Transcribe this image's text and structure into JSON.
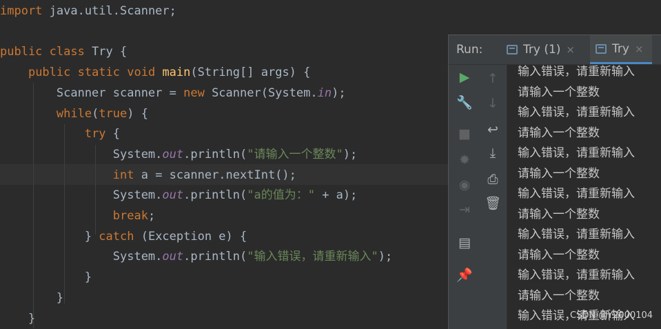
{
  "editor": {
    "lines": [
      {
        "parts": [
          {
            "c": "kw",
            "t": "import"
          },
          {
            "c": "",
            "t": " java.util.Scanner;"
          }
        ]
      },
      {
        "parts": []
      },
      {
        "parts": [
          {
            "c": "kw",
            "t": "public class"
          },
          {
            "c": "",
            "t": " Try {"
          }
        ]
      },
      {
        "parts": [
          {
            "c": "",
            "t": "    "
          },
          {
            "c": "kw",
            "t": "public static void"
          },
          {
            "c": "",
            "t": " "
          },
          {
            "c": "fn",
            "t": "main"
          },
          {
            "c": "",
            "t": "(String[] args) {"
          }
        ]
      },
      {
        "parts": [
          {
            "c": "",
            "t": "        Scanner scanner = "
          },
          {
            "c": "kw",
            "t": "new"
          },
          {
            "c": "",
            "t": " Scanner(System."
          },
          {
            "c": "fld",
            "t": "in"
          },
          {
            "c": "",
            "t": ");"
          }
        ]
      },
      {
        "parts": [
          {
            "c": "",
            "t": "        "
          },
          {
            "c": "kw",
            "t": "while"
          },
          {
            "c": "",
            "t": "("
          },
          {
            "c": "kw",
            "t": "true"
          },
          {
            "c": "",
            "t": ") {"
          }
        ]
      },
      {
        "parts": [
          {
            "c": "",
            "t": "            "
          },
          {
            "c": "kw",
            "t": "try"
          },
          {
            "c": "",
            "t": " {"
          }
        ]
      },
      {
        "parts": [
          {
            "c": "",
            "t": "                System."
          },
          {
            "c": "fld",
            "t": "out"
          },
          {
            "c": "",
            "t": ".println("
          },
          {
            "c": "str",
            "t": "\"请输入一个整数\""
          },
          {
            "c": "",
            "t": ");"
          }
        ]
      },
      {
        "parts": [
          {
            "c": "",
            "t": "                "
          },
          {
            "c": "kw",
            "t": "int"
          },
          {
            "c": "",
            "t": " a = scanner.nextInt();"
          }
        ]
      },
      {
        "parts": [
          {
            "c": "",
            "t": "                System."
          },
          {
            "c": "fld",
            "t": "out"
          },
          {
            "c": "",
            "t": ".println("
          },
          {
            "c": "str",
            "t": "\"a的值为：\""
          },
          {
            "c": "",
            "t": " + a);"
          }
        ]
      },
      {
        "parts": [
          {
            "c": "",
            "t": "                "
          },
          {
            "c": "kw",
            "t": "break"
          },
          {
            "c": "",
            "t": ";"
          }
        ]
      },
      {
        "parts": [
          {
            "c": "",
            "t": "            } "
          },
          {
            "c": "kw",
            "t": "catch"
          },
          {
            "c": "",
            "t": " (Exception e) {"
          }
        ]
      },
      {
        "parts": [
          {
            "c": "",
            "t": "                System."
          },
          {
            "c": "fld",
            "t": "out"
          },
          {
            "c": "",
            "t": ".println("
          },
          {
            "c": "str",
            "t": "\"输入错误，请重新输入\""
          },
          {
            "c": "",
            "t": ");"
          }
        ]
      },
      {
        "parts": [
          {
            "c": "",
            "t": "            }"
          }
        ]
      },
      {
        "parts": [
          {
            "c": "",
            "t": "        }"
          }
        ]
      },
      {
        "parts": [
          {
            "c": "",
            "t": "    }"
          }
        ]
      }
    ]
  },
  "run": {
    "title": "Run:",
    "tabs": [
      {
        "label": "Try (1)",
        "close": "×"
      },
      {
        "label": "Try",
        "close": "×"
      }
    ],
    "console_lines": [
      "输入错误，请重新输入",
      "请输入一个整数",
      "输入错误，请重新输入",
      "请输入一个整数",
      "输入错误，请重新输入",
      "请输入一个整数",
      "输入错误，请重新输入",
      "请输入一个整数",
      "输入错误，请重新输入",
      "请输入一个整数",
      "输入错误，请重新输入",
      "请输入一个整数",
      "输入错误，请重新输入"
    ],
    "icons": {
      "run": "▶",
      "wrench": "🔧",
      "stop": "■",
      "debug": "✹",
      "camera": "◉",
      "login": "⇥",
      "layout": "▤",
      "pin": "📌",
      "up": "↑",
      "down": "↓",
      "wrap": "↩",
      "scroll": "⤓",
      "print": "⎙",
      "trash": "🗑"
    }
  },
  "watermark": "CSDN @Y2000104"
}
